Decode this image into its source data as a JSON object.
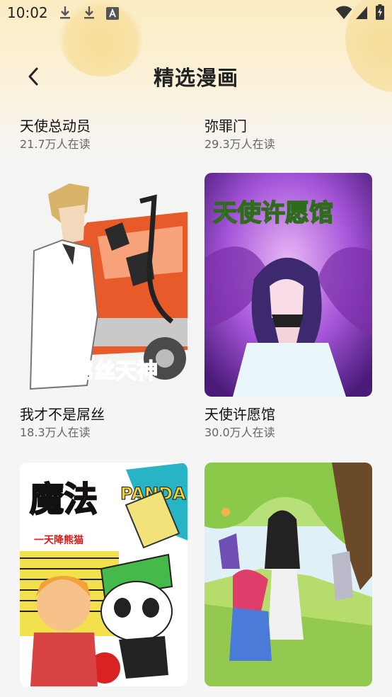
{
  "status_bar": {
    "time": "10:02",
    "left_icons": [
      "download-icon",
      "download-icon",
      "font-a-icon"
    ],
    "right_icons": [
      "wifi-icon",
      "signal-icon",
      "battery-charging-icon"
    ]
  },
  "header": {
    "title": "精选漫画",
    "back_icon": "chevron-left-icon"
  },
  "comics": [
    {
      "title": "天使总动员",
      "reads": "21.7万人在读"
    },
    {
      "title": "弥罪门",
      "reads": "29.3万人在读"
    },
    {
      "title": "我才不是屌丝",
      "reads": "18.3万人在读",
      "cover_text": "屌丝天神"
    },
    {
      "title": "天使许愿馆",
      "reads": "30.0万人在读",
      "cover_text": "天使许愿馆"
    },
    {
      "title": "",
      "reads": "",
      "cover_text": "魔法",
      "cover_text_2": "PANDA",
      "cover_text_3": "一天降熊猫"
    },
    {
      "title": "",
      "reads": ""
    }
  ],
  "colors": {
    "accent_yellow": "#fbecc2",
    "background": "#f5f5f5",
    "text_primary": "#111111",
    "text_secondary": "#666666"
  }
}
